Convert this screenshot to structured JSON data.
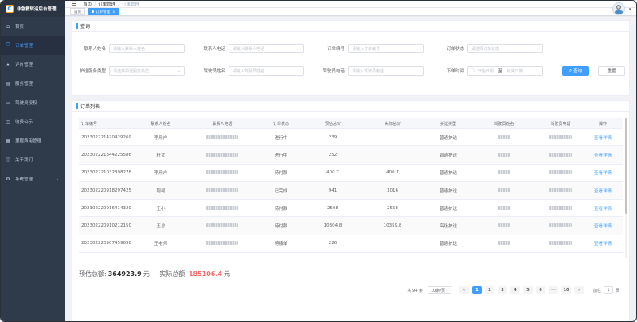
{
  "app": {
    "title": "非急救转运后台管理",
    "logo_letter": "C"
  },
  "sidebar": {
    "items": [
      {
        "label": "首页",
        "icon": "home-icon"
      },
      {
        "label": "订单管理",
        "icon": "cart-icon",
        "active": true
      },
      {
        "label": "评价管理",
        "icon": "star-icon"
      },
      {
        "label": "服务管理",
        "icon": "service-icon"
      },
      {
        "label": "驾驶员授权",
        "icon": "id-card-icon"
      },
      {
        "label": "收费公示",
        "icon": "money-icon"
      },
      {
        "label": "里程费用管理",
        "icon": "route-icon"
      },
      {
        "label": "关于我们",
        "icon": "user-icon"
      },
      {
        "label": "系统管理",
        "icon": "gear-icon"
      }
    ]
  },
  "navbar": {
    "breadcrumb": [
      "首页",
      "订单管理",
      "订单管理"
    ]
  },
  "tags": [
    {
      "label": "首页"
    },
    {
      "label": "订单管理"
    }
  ],
  "search": {
    "title": "查询",
    "fields": {
      "contact_name": {
        "label": "联系人姓名",
        "placeholder": "请输入联系人姓名"
      },
      "contact_phone": {
        "label": "联系人电话",
        "placeholder": "请输入联系人电话"
      },
      "order_no": {
        "label": "订单编号",
        "placeholder": "请输入订单编号"
      },
      "order_status": {
        "label": "订单状态",
        "placeholder": "请选择订单状态"
      },
      "escort_type": {
        "label": "护送服务类型",
        "placeholder": "请选择护送服务类型"
      },
      "driver_name": {
        "label": "驾驶员姓名",
        "placeholder": "请输入驾驶员姓名"
      },
      "driver_phone": {
        "label": "驾驶员电话",
        "placeholder": "请输入驾驶员电话"
      },
      "order_time": {
        "label": "下单时间",
        "start": "开始日期",
        "to": "至",
        "end": "结束日期"
      }
    },
    "query_button": "查询",
    "reset_button": "重置"
  },
  "list": {
    "title": "订单列表",
    "columns": [
      "订单编号",
      "联系人姓名",
      "联系人电话",
      "订单状态",
      "预估总价",
      "实际总价",
      "护送类型",
      "驾驶员姓名",
      "驾驶员电话",
      "操作"
    ],
    "rows": [
      {
        "order_no": "202302221420429269",
        "name": "李用户",
        "status": "进行中",
        "est": "239",
        "actual": "",
        "type": "普通护送",
        "action": "查看详情"
      },
      {
        "order_no": "202302221344225586",
        "name": "杜文",
        "status": "进行中",
        "est": "252",
        "actual": "",
        "type": "普通护送",
        "action": "查看详情"
      },
      {
        "order_no": "202302221032398278",
        "name": "李用户",
        "status": "待付款",
        "est": "400.7",
        "actual": "400.7",
        "type": "普通护送",
        "action": "查看详情"
      },
      {
        "order_no": "202302220918297425",
        "name": "阿柯",
        "status": "已完成",
        "est": "941",
        "actual": "1016",
        "type": "普通护送",
        "action": "查看详情"
      },
      {
        "order_no": "202302220916414329",
        "name": "王小",
        "status": "待付款",
        "est": "2508",
        "actual": "2558",
        "type": "普通护送",
        "action": "查看详情"
      },
      {
        "order_no": "202302220910212150",
        "name": "王总",
        "status": "待付款",
        "est": "10304.8",
        "actual": "10359.8",
        "type": "高级护送",
        "action": "查看详情"
      },
      {
        "order_no": "202302220907459696",
        "name": "王老师",
        "status": "待接单",
        "est": "226",
        "actual": "",
        "type": "普通护送",
        "action": "查看详情"
      }
    ],
    "summary": {
      "est_label": "预估总额:",
      "est_value": "364923.9",
      "est_unit": "元",
      "actual_label": "实际总额:",
      "actual_value": "185106.4",
      "actual_unit": "元"
    },
    "pagination": {
      "total": "共 94 条",
      "page_size": "10条/页",
      "pages": [
        "1",
        "2",
        "3",
        "4",
        "5",
        "6",
        "···",
        "10"
      ],
      "current": "1",
      "goto_label": "前往",
      "goto_value": "1",
      "goto_suffix": "页",
      "prev": "‹",
      "next": "›"
    }
  },
  "colors": {
    "primary": "#409eff",
    "sidebar_bg": "#2f3a4a",
    "danger": "#f56c6c"
  }
}
